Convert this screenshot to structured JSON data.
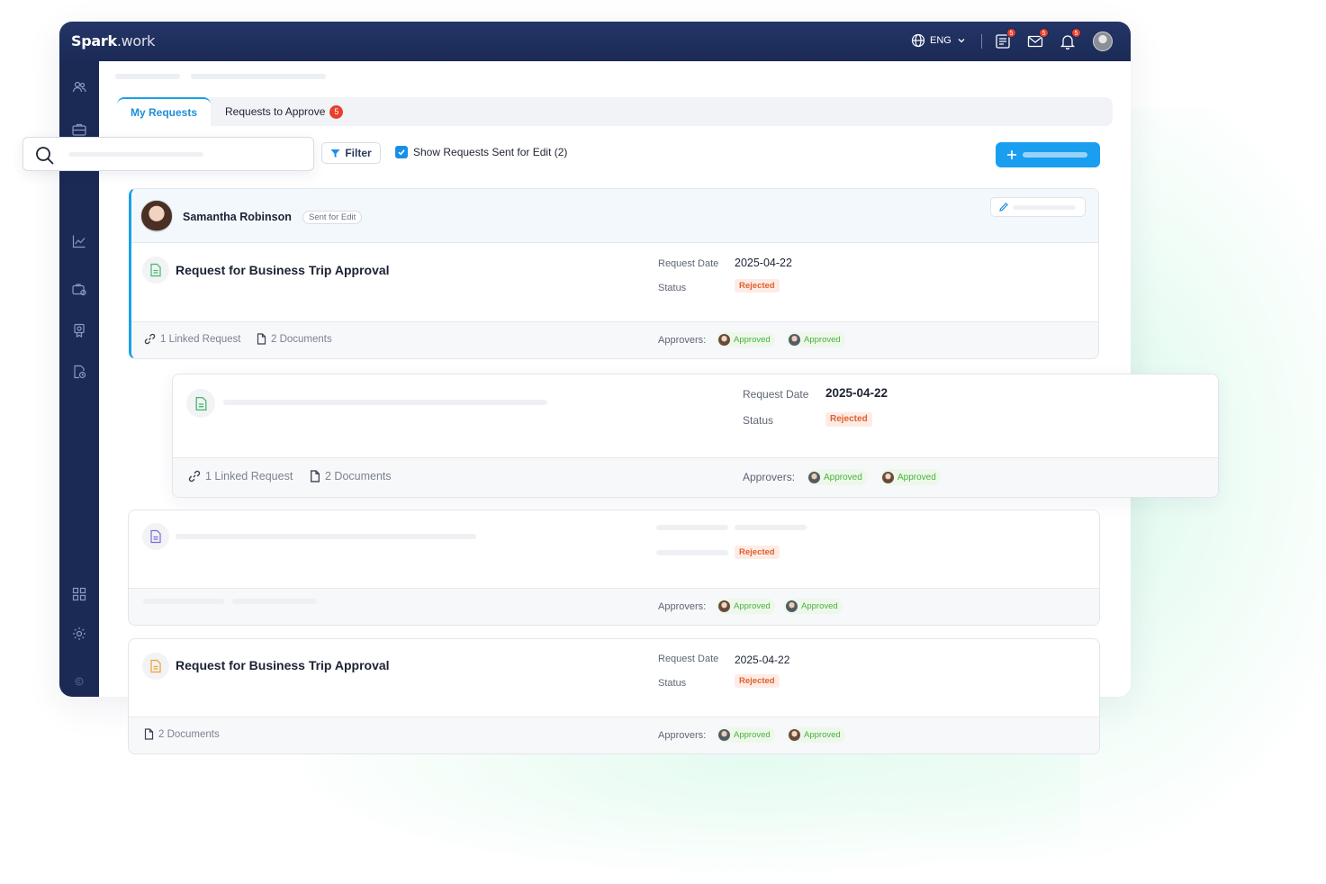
{
  "app": {
    "brand_bold": "Spark",
    "brand_light": ".work"
  },
  "topbar": {
    "language": "ENG",
    "requests_badge": "5",
    "mail_badge": "5",
    "notifications_badge": "5"
  },
  "tabs": {
    "my_requests": "My Requests",
    "to_approve": "Requests to Approve",
    "to_approve_count": "5"
  },
  "toolbar": {
    "filter_label": "Filter",
    "show_sent_label": "Show Requests Sent for Edit (2)",
    "show_sent_checked": true
  },
  "cards": [
    {
      "user_name": "Samantha Robinson",
      "user_tag": "Sent for Edit",
      "title": "Request for Business Trip Approval",
      "request_date_label": "Request Date",
      "request_date": "2025-04-22",
      "status_label": "Status",
      "status": "Rejected",
      "linked": "1 Linked Request",
      "documents": "2 Documents",
      "approvers_label": "Approvers:",
      "approvers": [
        "Approved",
        "Approved"
      ]
    },
    {
      "request_date_label": "Request Date",
      "request_date": "2025-04-22",
      "status_label": "Status",
      "status": "Rejected",
      "linked": "1 Linked Request",
      "documents": "2 Documents",
      "approvers_label": "Approvers:",
      "approvers": [
        "Approved",
        "Approved"
      ]
    },
    {
      "status": "Rejected",
      "approvers_label": "Approvers:",
      "approvers": [
        "Approved",
        "Approved"
      ]
    },
    {
      "title": "Request for Business Trip Approval",
      "request_date_label": "Request Date",
      "request_date": "2025-04-22",
      "status_label": "Status",
      "status": "Rejected",
      "documents": "2 Documents",
      "approvers_label": "Approvers:",
      "approvers": [
        "Approved",
        "Approved"
      ]
    }
  ],
  "colors": {
    "nav": "#1b2a55",
    "accent": "#1a9ef0",
    "approved": "#49b03e",
    "rejected": "#e0602e"
  }
}
